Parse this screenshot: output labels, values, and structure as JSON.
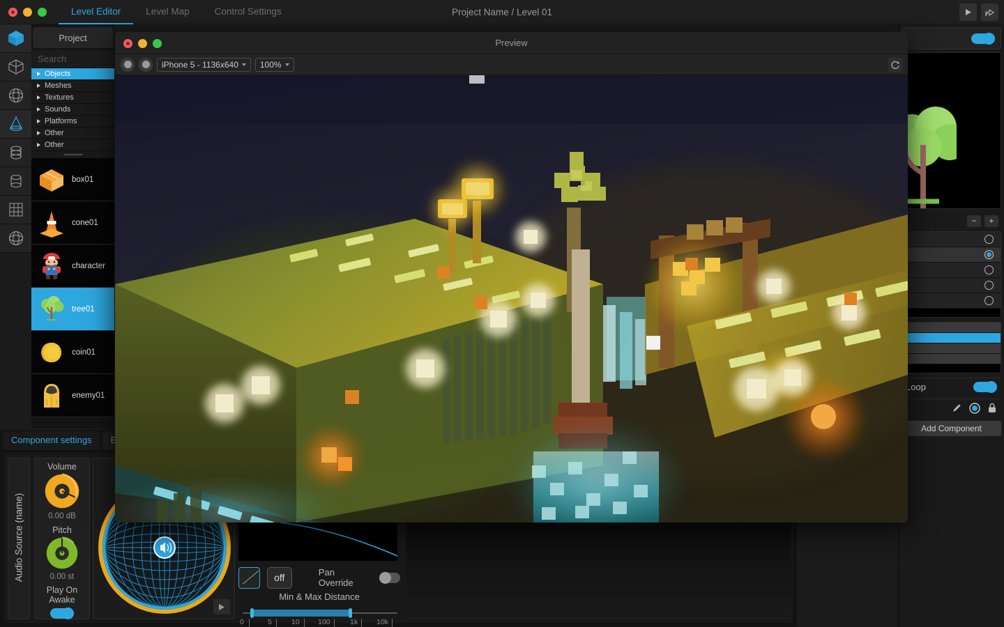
{
  "window": {
    "title": "Project Name / Level 01",
    "tabs": [
      {
        "label": "Level Editor",
        "active": true
      },
      {
        "label": "Level Map",
        "active": false
      },
      {
        "label": "Control Settings",
        "active": false
      }
    ],
    "topright": [
      {
        "name": "play-button",
        "icon": "play-icon"
      },
      {
        "name": "share-button",
        "icon": "share-icon"
      }
    ],
    "traffic_lights": [
      "close",
      "minimize",
      "zoom"
    ]
  },
  "rail": {
    "items": [
      {
        "name": "cube-icon",
        "selected": true
      },
      {
        "name": "wireframe-cube-icon",
        "selected": false
      },
      {
        "name": "sphere-icon",
        "selected": false
      },
      {
        "name": "cone-icon",
        "selected": true
      },
      {
        "name": "capsule-icon",
        "selected": false
      },
      {
        "name": "cylinder-icon",
        "selected": false
      },
      {
        "name": "plane-grid-icon",
        "selected": false
      },
      {
        "name": "globe-icon",
        "selected": false
      }
    ]
  },
  "project": {
    "header": "Project",
    "search_placeholder": "Search",
    "tree": [
      {
        "label": "Objects",
        "selected": true
      },
      {
        "label": "Meshes",
        "selected": false
      },
      {
        "label": "Textures",
        "selected": false
      },
      {
        "label": "Sounds",
        "selected": false
      },
      {
        "label": "Platforms",
        "selected": false
      },
      {
        "label": "Other",
        "selected": false
      },
      {
        "label": "Other",
        "selected": false
      }
    ],
    "objects": [
      {
        "label": "box01",
        "icon": "box-icon",
        "selected": false
      },
      {
        "label": "cone01",
        "icon": "traffic-cone-icon",
        "selected": false
      },
      {
        "label": "character",
        "icon": "character-icon",
        "selected": false
      },
      {
        "label": "tree01",
        "icon": "tree-icon",
        "selected": true
      },
      {
        "label": "coin01",
        "icon": "coin-icon",
        "selected": false
      },
      {
        "label": "enemy01",
        "icon": "enemy-icon",
        "selected": false
      }
    ]
  },
  "component_panel": {
    "tabs": [
      {
        "label": "Component settings",
        "active": true
      },
      {
        "label": "E",
        "active": false
      }
    ],
    "vertical_label": "Audio Source (name)",
    "volume": {
      "label": "Volume",
      "value": "0.00 dB",
      "color": "#f0a81e"
    },
    "pitch": {
      "label": "Pitch",
      "value": "0.00 st",
      "color": "#7fb82b"
    },
    "play_on": {
      "label_line1": "Play On",
      "label_line2": "Awake",
      "enabled": true
    },
    "pan_override": {
      "label": "Pan Override",
      "enabled": false
    },
    "rolloff_mode": "off",
    "distance": {
      "label": "Min & Max Distance",
      "ticks": [
        "0",
        "5",
        "10",
        "100",
        "1k",
        "10k"
      ],
      "min_pos_pct": 6,
      "max_pos_pct": 70
    }
  },
  "inspector": {
    "enabled_toggle": true,
    "thumbnail": "tree-thumbnail",
    "stepper": {
      "minus": "−",
      "plus": "+"
    },
    "radio_items": [
      {
        "selected": false
      },
      {
        "selected": true
      },
      {
        "selected": false
      },
      {
        "selected": false
      },
      {
        "selected": false
      }
    ],
    "bar_items": [
      {
        "selected": false
      },
      {
        "selected": true
      },
      {
        "selected": false
      },
      {
        "selected": false
      }
    ],
    "loop": {
      "label": "Loop",
      "enabled": true
    },
    "tool_icons": [
      "pencil-icon",
      "record-icon",
      "lock-icon"
    ],
    "add_component_label": "Add Component"
  },
  "preview": {
    "title": "Preview",
    "device": "iPhone 5 - 1136x640",
    "zoom": "100%",
    "refresh_icon": "refresh-icon",
    "scene": "voxel-night-city-waterfall"
  }
}
